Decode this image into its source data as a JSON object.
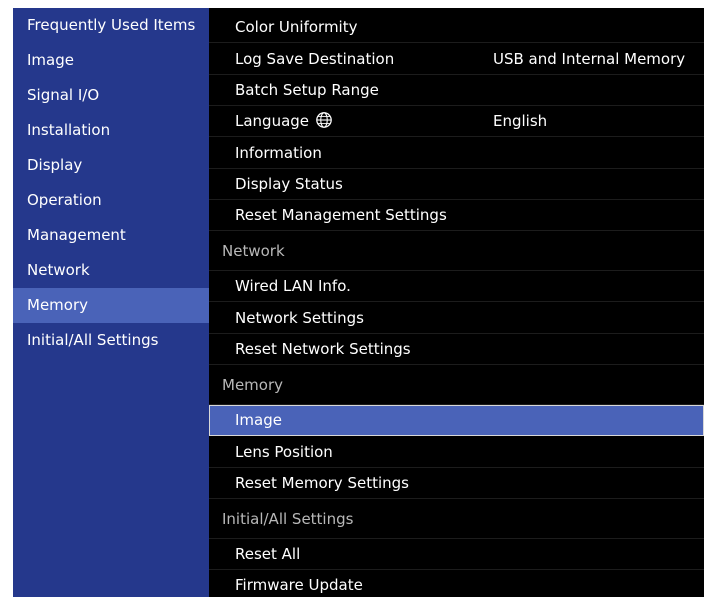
{
  "sidebar": {
    "items": [
      {
        "label": "Frequently Used Items",
        "active": false
      },
      {
        "label": "Image",
        "active": false
      },
      {
        "label": "Signal I/O",
        "active": false
      },
      {
        "label": "Installation",
        "active": false
      },
      {
        "label": "Display",
        "active": false
      },
      {
        "label": "Operation",
        "active": false
      },
      {
        "label": "Management",
        "active": false
      },
      {
        "label": "Network",
        "active": false
      },
      {
        "label": "Memory",
        "active": true
      },
      {
        "label": "Initial/All Settings",
        "active": false
      }
    ]
  },
  "main": {
    "management": {
      "color_uniformity": "Color Uniformity",
      "log_save_destination": "Log Save Destination",
      "log_save_destination_value": "USB and Internal Memory",
      "batch_setup_range": "Batch Setup Range",
      "language": "Language",
      "language_value": "English",
      "information": "Information",
      "display_status": "Display Status",
      "reset_management_settings": "Reset Management Settings"
    },
    "network": {
      "header": "Network",
      "wired_lan_info": "Wired LAN Info.",
      "network_settings": "Network Settings",
      "reset_network_settings": "Reset Network Settings"
    },
    "memory": {
      "header": "Memory",
      "image": "Image",
      "lens_position": "Lens Position",
      "reset_memory_settings": "Reset Memory Settings"
    },
    "initial_all": {
      "header": "Initial/All Settings",
      "reset_all": "Reset All",
      "firmware_update": "Firmware Update"
    }
  },
  "icons": {
    "language": "globe-icon"
  },
  "colors": {
    "sidebar_bg": "#25388c",
    "selected_bg": "#4a63b8",
    "panel_bg": "#000000",
    "section_text": "#b8b8b8"
  }
}
